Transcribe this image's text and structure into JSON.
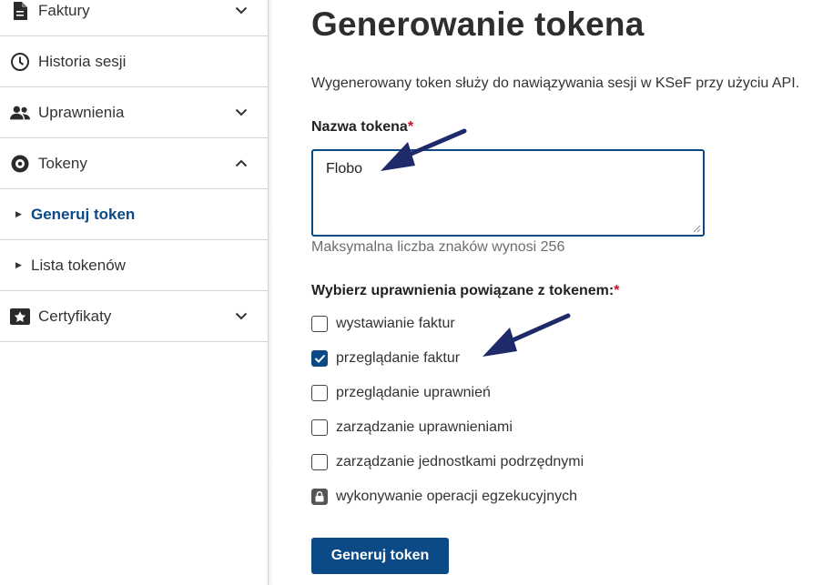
{
  "sidebar": {
    "items": [
      {
        "label": "Faktury",
        "icon": "document-icon",
        "chevron": "down"
      },
      {
        "label": "Historia sesji",
        "icon": "clock-icon",
        "chevron": ""
      },
      {
        "label": "Uprawnienia",
        "icon": "users-icon",
        "chevron": "down"
      },
      {
        "label": "Tokeny",
        "icon": "token-icon",
        "chevron": "up"
      },
      {
        "label": "Generuj token",
        "sub": true,
        "active": true
      },
      {
        "label": "Lista tokenów",
        "sub": true,
        "active": false
      },
      {
        "label": "Certyfikaty",
        "icon": "certificate-icon",
        "chevron": "down"
      }
    ]
  },
  "main": {
    "title": "Generowanie tokena",
    "description": "Wygenerowany token służy do nawiązywania sesji w KSeF przy użyciu API.",
    "token_name_label": "Nazwa tokena",
    "required_marker": "*",
    "token_name_value": "Flobo",
    "token_name_hint": "Maksymalna liczba znaków wynosi 256",
    "permissions_label": "Wybierz uprawnienia powiązane z tokenem:",
    "permissions": [
      {
        "label": "wystawianie faktur",
        "checked": false,
        "locked": false
      },
      {
        "label": "przeglądanie faktur",
        "checked": true,
        "locked": false
      },
      {
        "label": "przeglądanie uprawnień",
        "checked": false,
        "locked": false
      },
      {
        "label": "zarządzanie uprawnieniami",
        "checked": false,
        "locked": false
      },
      {
        "label": "zarządzanie jednostkami podrzędnymi",
        "checked": false,
        "locked": false
      },
      {
        "label": "wykonywanie operacji egzekucyjnych",
        "checked": false,
        "locked": true
      }
    ],
    "submit_label": "Generuj token"
  },
  "colors": {
    "primary": "#0b4a86",
    "required": "#c8102e",
    "annotation_arrow": "#1f2a6b"
  }
}
